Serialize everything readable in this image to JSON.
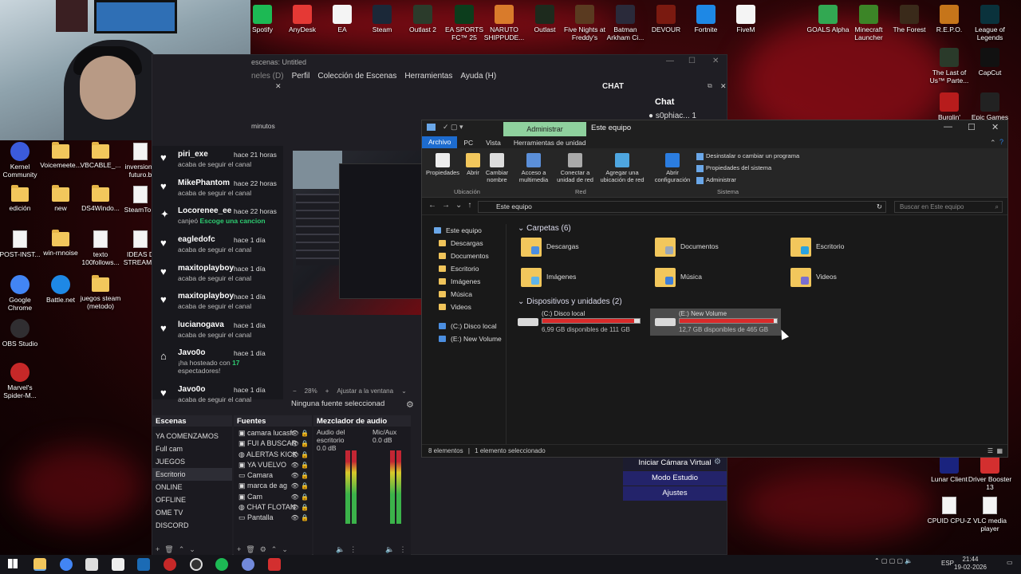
{
  "desktop": {
    "top_icons": [
      {
        "label": "Spotify",
        "color": "#1DB954"
      },
      {
        "label": "AnyDesk",
        "color": "#e53935"
      },
      {
        "label": "EA",
        "color": "#f4f4f4"
      },
      {
        "label": "Steam",
        "color": "#1b2838"
      },
      {
        "label": "Outlast 2",
        "color": "#2b3b2b"
      },
      {
        "label": "EA SPORTS FC™ 25",
        "color": "#0c3d1c"
      },
      {
        "label": "NARUTO SHIPPUDE...",
        "color": "#d97b2b"
      },
      {
        "label": "Outlast",
        "color": "#1d2a1d"
      },
      {
        "label": "Five Nights at Freddy's",
        "color": "#5a3a20"
      },
      {
        "label": "Batman Arkham Ci...",
        "color": "#2a2a3a"
      },
      {
        "label": "DEVOUR",
        "color": "#7a1a10"
      },
      {
        "label": "Fortnite",
        "color": "#1e88e5"
      },
      {
        "label": "FiveM",
        "color": "#f4f4f4"
      },
      {
        "label": "GOALS Alpha",
        "color": "#32a852"
      },
      {
        "label": "Minecraft Launcher",
        "color": "#3c8527"
      },
      {
        "label": "The Forest",
        "color": "#3a2a1a"
      },
      {
        "label": "R.E.P.O.",
        "color": "#c6751a"
      },
      {
        "label": "League of Legends",
        "color": "#0a323c"
      }
    ],
    "left_icons": [
      {
        "label": "Kernel Community",
        "color": "#3b5bdb"
      },
      {
        "label": "Voicemeete...",
        "color": "#f2c75c"
      },
      {
        "label": "VBCABLE_...",
        "color": "#f2c75c"
      },
      {
        "label": "inversione futuro.b",
        "color": "#f4f4f4"
      },
      {
        "label": "edición",
        "color": "#f2c75c"
      },
      {
        "label": "new",
        "color": "#f2c75c"
      },
      {
        "label": "DS4Windo...",
        "color": "#f2c75c"
      },
      {
        "label": "SteamTo...",
        "color": "#f4f4f4"
      },
      {
        "label": "POST-INST...",
        "color": "#f4f4f4"
      },
      {
        "label": "win-rnnoise",
        "color": "#f2c75c"
      },
      {
        "label": "texto 100follows...",
        "color": "#f4f4f4"
      },
      {
        "label": "IDEAS D STREAM...",
        "color": "#f4f4f4"
      },
      {
        "label": "Google Chrome",
        "color": "#4285f4"
      },
      {
        "label": "Battle.net",
        "color": "#1e88e5"
      },
      {
        "label": "juegos steam (metodo)",
        "color": "#f2c75c"
      },
      {
        "label": "OBS Studio",
        "color": "#302e31"
      },
      {
        "label": "Marvel's Spider-M...",
        "color": "#c62828"
      }
    ],
    "right_icons": [
      {
        "label": "The Last of Us™ Parte...",
        "color": "#2a3a2a"
      },
      {
        "label": "CapCut",
        "color": "#111111"
      },
      {
        "label": "Burglin'",
        "color": "#b71c1c"
      },
      {
        "label": "Epic Games",
        "color": "#222222"
      },
      {
        "label": "Lunar Client",
        "color": "#1a237e"
      },
      {
        "label": "Driver Booster 13",
        "color": "#d32f2f"
      },
      {
        "label": "CPUID CPU-Z",
        "color": "#f4f4f4"
      },
      {
        "label": "VLC media player",
        "color": "#f4f4f4"
      }
    ]
  },
  "obs": {
    "title": "escenas: Untitled",
    "menu": [
      "neles (D)",
      "Perfil",
      "Colección de Escenas",
      "Herramientas",
      "Ayuda (H)"
    ],
    "left_panel_label": "minutos",
    "chat_panel_title": "CHAT",
    "chat_header": "Chat",
    "chat_user": "s0phiac... 1",
    "events": [
      {
        "name": "piri_exe",
        "time": "hace 21 horas",
        "desc": "acaba de seguir el canal",
        "highlight": ""
      },
      {
        "name": "MikePhantom",
        "time": "hace 22 horas",
        "desc": "acaba de seguir el canal",
        "highlight": ""
      },
      {
        "name": "Locorenee_ee",
        "time": "hace 22 horas",
        "desc": "canjeó",
        "highlight": "Escoge una cancion"
      },
      {
        "name": "eagledofc",
        "time": "hace 1 día",
        "desc": "acaba de seguir el canal",
        "highlight": ""
      },
      {
        "name": "maxitoplayboy",
        "time": "hace 1 día",
        "desc": "acaba de seguir el canal",
        "highlight": ""
      },
      {
        "name": "maxitoplayboy",
        "time": "hace 1 día",
        "desc": "acaba de seguir el canal",
        "highlight": ""
      },
      {
        "name": "lucianogava",
        "time": "hace 1 día",
        "desc": "acaba de seguir el canal",
        "highlight": ""
      },
      {
        "name": "Javo0o",
        "time": "hace 1 día",
        "desc": "¡ha hosteado con",
        "highlight": "17",
        "desc2": "espectadores!"
      },
      {
        "name": "Javo0o",
        "time": "hace 1 día",
        "desc": "acaba de seguir el canal",
        "highlight": ""
      }
    ],
    "zoom": "28%",
    "fit": "Ajustar a la ventana",
    "no_source": "Ninguna fuente seleccionad",
    "docks": {
      "scenes_title": "Escenas",
      "sources_title": "Fuentes",
      "mixer_title": "Mezclador de audio",
      "scenes": [
        "YA COMENZAMOS",
        "Full cam",
        "JUEGOS",
        "Escritorio",
        "ONLINE",
        "OFFLINE",
        "OME TV",
        "DISCORD"
      ],
      "active_scene": "Escritorio",
      "sources": [
        "camara lucasfr",
        "FUI A BUSCAR",
        "ALERTAS KICK",
        "YA VUELVO",
        "Camara",
        "marca de ag",
        "Cam",
        "CHAT FLOTAN",
        "Pantalla"
      ],
      "mixer_channels": [
        {
          "name": "Audio del escritorio",
          "db": "0.0 dB"
        },
        {
          "name": "Mic/Aux",
          "db": "0.0 dB"
        }
      ]
    },
    "controls": [
      "Iniciar Cámara Virtual",
      "Modo Estudio",
      "Ajustes"
    ]
  },
  "explorer": {
    "admin_tab": "Administrar",
    "title": "Este equipo",
    "tabs": [
      "Archivo",
      "PC",
      "Vista",
      "Herramientas de unidad"
    ],
    "ribbon": {
      "buttons": [
        "Propiedades",
        "Abrir",
        "Cambiar nombre",
        "Acceso a multimedia",
        "Conectar a unidad de red",
        "Agregar una ubicación de red",
        "Abrir configuración"
      ],
      "small": [
        "Desinstalar o cambiar un programa",
        "Propiedades del sistema",
        "Administrar"
      ],
      "groups": [
        "Ubicación",
        "Red",
        "Sistema"
      ]
    },
    "address": "Este equipo",
    "search_placeholder": "Buscar en Este equipo",
    "nav": [
      "Este equipo",
      "Descargas",
      "Documentos",
      "Escritorio",
      "Imágenes",
      "Música",
      "Videos",
      "(C:) Disco local",
      "(E:) New Volume"
    ],
    "folders_title": "Carpetas (6)",
    "folders": [
      {
        "name": "Descargas",
        "badge": "#4b8ee0"
      },
      {
        "name": "Documentos",
        "badge": "#9aa7b8"
      },
      {
        "name": "Escritorio",
        "badge": "#29a3e0"
      },
      {
        "name": "Imágenes",
        "badge": "#5fb4e8"
      },
      {
        "name": "Música",
        "badge": "#3f7fd8"
      },
      {
        "name": "Videos",
        "badge": "#7a6fd0"
      }
    ],
    "drives_title": "Dispositivos y unidades (2)",
    "drives": [
      {
        "name": "(C:) Disco local",
        "free": "6,99 GB disponibles de 111 GB",
        "used_fraction": 0.94
      },
      {
        "name": "(E:) New Volume",
        "free": "12,7 GB disponibles de 465 GB",
        "used_fraction": 0.97
      }
    ],
    "status_count": "8 elementos",
    "status_selected": "1 elemento seleccionado"
  },
  "taskbar": {
    "lang": "ESP",
    "time": "21:44",
    "date": "19-02-2026"
  }
}
